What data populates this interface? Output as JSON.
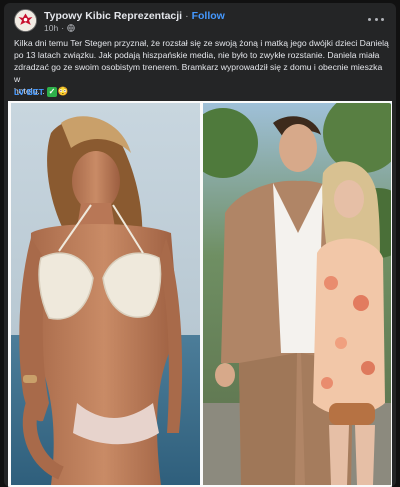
{
  "post": {
    "author": "Typowy Kibic Reprezentacji",
    "separator": "·",
    "follow_label": "Follow",
    "time": "10h",
    "privacy_icon": "globe-icon",
    "text_lines": [
      "Kilka dni temu Ter Stegen przyznał, że rozstał się ze swoją żoną i matką jego dwójki dzieci Danielą",
      "po 13 latach związku. Jak podają hiszpańskie media, nie było to zwykłe rozstanie. Daniela miała",
      "zdradzać go ze swoim osobistym trenerem. Bramkarz wyprowadził się z domu i obecnie mieszka w",
      "hotelu... 👀😳"
    ],
    "tag": "LV BET",
    "tag_badge": "✓",
    "colors": {
      "accent": "#4599ff",
      "card": "#242526",
      "text": "#e4e6eb",
      "muted": "#b0b3b8"
    }
  }
}
